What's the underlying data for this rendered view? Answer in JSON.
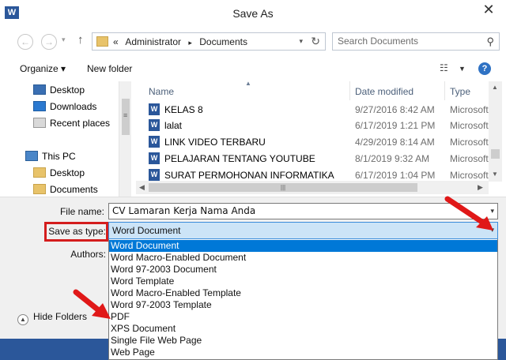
{
  "window": {
    "title": "Save As",
    "app_icon": "W",
    "close_glyph": "✕"
  },
  "address_bar": {
    "prefix": "«",
    "crumbs": [
      "Administrator",
      "Documents"
    ],
    "separator": "▸"
  },
  "search": {
    "placeholder": "Search Documents"
  },
  "toolbar": {
    "organize_label": "Organize ▾",
    "new_folder_label": "New folder",
    "help_glyph": "?"
  },
  "nav_pane": {
    "items": [
      {
        "label": "Desktop",
        "icon": "desktop-icon"
      },
      {
        "label": "Downloads",
        "icon": "downloads-icon"
      },
      {
        "label": "Recent places",
        "icon": "recent-places-icon"
      },
      {
        "label": "This PC",
        "icon": "pc-icon"
      },
      {
        "label": "Desktop",
        "icon": "folder-icon"
      },
      {
        "label": "Documents",
        "icon": "folder-icon"
      }
    ]
  },
  "file_list": {
    "columns": [
      "Name",
      "Date modified",
      "Type"
    ],
    "rows": [
      {
        "name": "KELAS 8",
        "date": "9/27/2016 8:42 AM",
        "type": "Microsoft"
      },
      {
        "name": "lalat",
        "date": "6/17/2019 1:21 PM",
        "type": "Microsoft"
      },
      {
        "name": "LINK VIDEO TERBARU",
        "date": "4/29/2019 8:14 AM",
        "type": "Microsoft"
      },
      {
        "name": "PELAJARAN TENTANG YOUTUBE",
        "date": "8/1/2019 9:32 AM",
        "type": "Microsoft"
      },
      {
        "name": "SURAT PERMOHONAN INFORMATIKA",
        "date": "6/17/2019 1:04 PM",
        "type": "Microsoft"
      }
    ]
  },
  "form": {
    "file_name_label": "File name:",
    "file_name_value": "CV Lamaran Kerja Nama Anda",
    "save_as_type_label": "Save as type:",
    "save_as_type_value": "Word Document",
    "authors_label": "Authors:",
    "type_options": [
      "Word Document",
      "Word Macro-Enabled Document",
      "Word 97-2003 Document",
      "Word Template",
      "Word Macro-Enabled Template",
      "Word 97-2003 Template",
      "PDF",
      "XPS Document",
      "Single File Web Page",
      "Web Page"
    ],
    "selected_option_index": 0,
    "hide_folders_label": "Hide Folders"
  },
  "accent_colors": {
    "selection": "#0078d7",
    "highlight_box": "#d41d1d",
    "word_blue": "#2b579a"
  }
}
